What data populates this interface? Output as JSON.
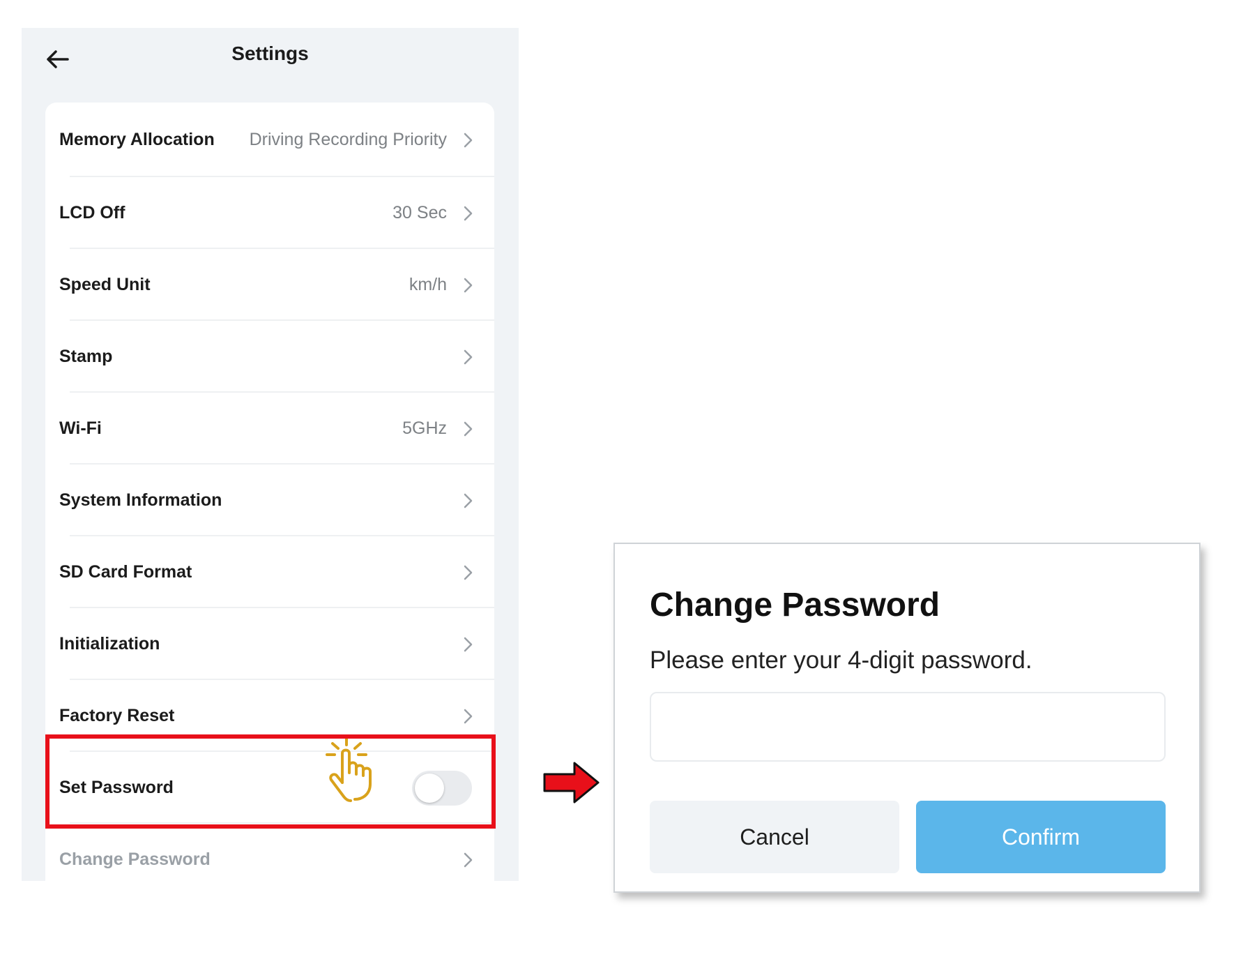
{
  "settings": {
    "title": "Settings",
    "back_icon": "arrow-left-icon",
    "items": [
      {
        "label": "Memory Allocation",
        "value": "Driving Recording Priority"
      },
      {
        "label": "LCD Off",
        "value": "30 Sec"
      },
      {
        "label": "Speed Unit",
        "value": "km/h"
      },
      {
        "label": "Stamp",
        "value": ""
      },
      {
        "label": "Wi-Fi",
        "value": "5GHz"
      },
      {
        "label": "System Information",
        "value": ""
      },
      {
        "label": "SD Card Format",
        "value": ""
      },
      {
        "label": "Initialization",
        "value": ""
      },
      {
        "label": "Factory Reset",
        "value": ""
      }
    ],
    "set_password": {
      "label": "Set Password",
      "enabled": false
    },
    "change_password": {
      "label": "Change Password",
      "disabled": true
    }
  },
  "annotations": {
    "highlight_color": "#e8101a",
    "tap_icon": "tap-hand-icon",
    "tap_color": "#d9a21b",
    "arrow_icon": "right-arrow-icon"
  },
  "dialog": {
    "title": "Change Password",
    "description": "Please enter your 4-digit password.",
    "input_value": "",
    "cancel_label": "Cancel",
    "confirm_label": "Confirm",
    "confirm_color": "#5bb6ea"
  }
}
